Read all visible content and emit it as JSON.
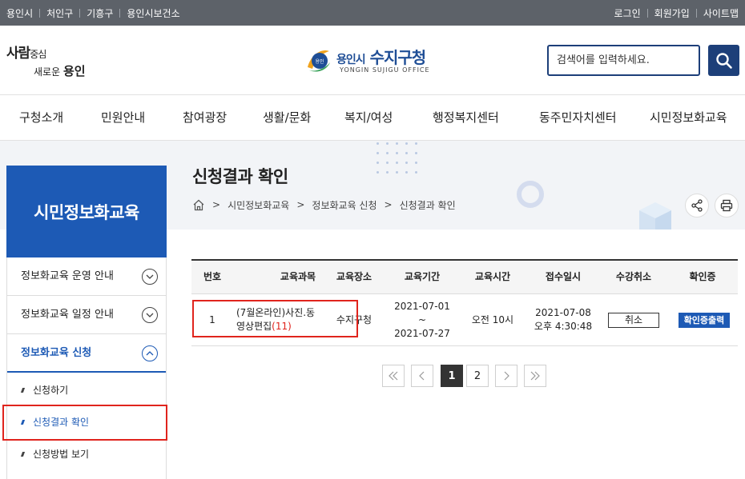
{
  "topbar": {
    "left_links": [
      "용인시",
      "처인구",
      "기흥구",
      "용인시보건소"
    ],
    "right_links": [
      "로그인",
      "회원가입",
      "사이트맵"
    ]
  },
  "header": {
    "slogan_line1_bold": "사람",
    "slogan_line1_rest": "중심",
    "slogan_line2_rest": "새로운",
    "slogan_line2_bold": "용인",
    "logo_small": "용인시",
    "logo_big": "수지구청",
    "logo_eng": "YONGIN SUJIGU OFFICE",
    "search_placeholder": "검색어를 입력하세요."
  },
  "gnb": [
    "구청소개",
    "민원안내",
    "참여광장",
    "생활/문화",
    "복지/여성",
    "행정복지센터",
    "동주민자치센터",
    "시민정보화교육"
  ],
  "page": {
    "title": "신청결과 확인",
    "breadcrumb": [
      "시민정보화교육",
      "정보화교육 신청",
      "신청결과 확인"
    ]
  },
  "sidebar": {
    "heading": "시민정보화교육",
    "items": [
      {
        "label": "정보화교육 운영 안내"
      },
      {
        "label": "정보화교육 일정 안내"
      },
      {
        "label": "정보화교육 신청"
      }
    ],
    "sub_items": [
      {
        "label": "신청하기"
      },
      {
        "label": "신청결과 확인"
      },
      {
        "label": "신청방법 보기"
      }
    ]
  },
  "table": {
    "headers": [
      "번호",
      "교육과목",
      "교육장소",
      "교육기간",
      "교육시간",
      "접수일시",
      "수강취소",
      "확인증"
    ],
    "rows": [
      {
        "no": "1",
        "course_line1": "(7월온라인)사진.동",
        "course_line2": "영상편집",
        "course_count": "(11)",
        "place": "수지구청",
        "period_line1": "2021-07-01 ~",
        "period_line2": "2021-07-27",
        "time": "오전 10시",
        "received_line1": "2021-07-08",
        "received_line2": "오후 4:30:48",
        "cancel_label": "취소",
        "cert_label": "확인증출력"
      }
    ]
  },
  "pagination": {
    "pages": [
      "1",
      "2"
    ],
    "current": "1"
  },
  "colors": {
    "topbar": "#5d6269",
    "navy": "#1d3f79",
    "primary": "#1d5ab5",
    "highlight": "#e0241d"
  }
}
